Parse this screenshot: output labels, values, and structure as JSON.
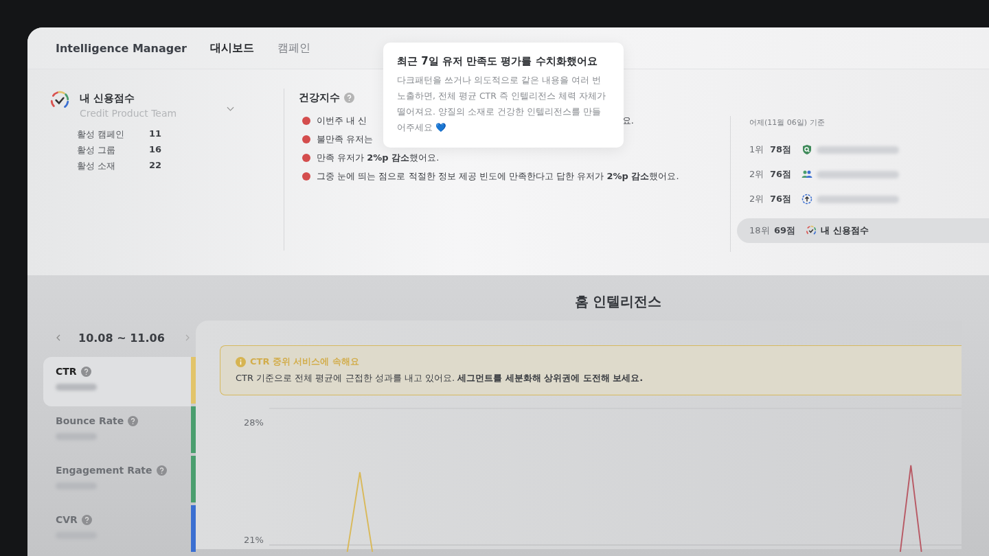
{
  "header": {
    "app_name": "Intelligence Manager",
    "tabs": [
      {
        "label": "대시보드",
        "selected": true
      },
      {
        "label": "캠페인",
        "selected": false
      }
    ]
  },
  "profile": {
    "name": "내 신용점수",
    "team": "Credit Product Team",
    "stats": [
      {
        "label": "활성 캠페인",
        "value": "11"
      },
      {
        "label": "활성 그룹",
        "value": "16"
      },
      {
        "label": "활성 소재",
        "value": "22"
      }
    ]
  },
  "health": {
    "title": "건강지수",
    "items": [
      {
        "text": "이번주 내 신",
        "tail": "요."
      },
      {
        "text": "불만족 유저는"
      },
      {
        "text": "만족 유저가 **2%p 감소**했어요."
      },
      {
        "text": "그중 눈에 띄는 점으로 적절한 정보 제공 빈도에 만족한다고 답한 유저가 **2%p 감소**했어요."
      }
    ]
  },
  "tooltip": {
    "title": "최근 7일 유저 만족도 평가를 수치화했어요",
    "body": "다크패턴을 쓰거나 의도적으로 같은 내용을 여러 번 노출하면, 전체 평균 CTR 즉 인텔리전스 체력 자체가 떨어져요. 양질의 소재로 건강한 인텔리전스를 만들어주세요 💙"
  },
  "ranking": {
    "caption": "어제(11월 06일) 기준",
    "rows": [
      {
        "rank": "1위",
        "score": "78점",
        "kind": "shield"
      },
      {
        "rank": "2위",
        "score": "76점",
        "kind": "people"
      },
      {
        "rank": "2위",
        "score": "76점",
        "kind": "upload"
      }
    ],
    "mine": {
      "rank": "18위",
      "score": "69점",
      "name": "내 신용점수"
    }
  },
  "section_title": "홈 인텔리전스",
  "date_range": "10.08 ~ 11.06",
  "metrics": [
    {
      "label": "CTR",
      "selected": true,
      "color": "#e2c46a"
    },
    {
      "label": "Bounce Rate",
      "selected": false,
      "color": "#4a9e6e"
    },
    {
      "label": "Engagement Rate",
      "selected": false,
      "color": "#4a9e6e"
    },
    {
      "label": "CVR",
      "selected": false,
      "color": "#3b6fd1"
    }
  ],
  "alert": {
    "title": "CTR 중위 서비스에 속해요",
    "body": "CTR 기준으로 전체 평균에 근접한 성과를 내고 있어요. **세그먼트를 세분화해 상위권에 도전해 보세요.**"
  },
  "chart": {
    "y_tick_labels": [
      "28%",
      "21%"
    ]
  }
}
